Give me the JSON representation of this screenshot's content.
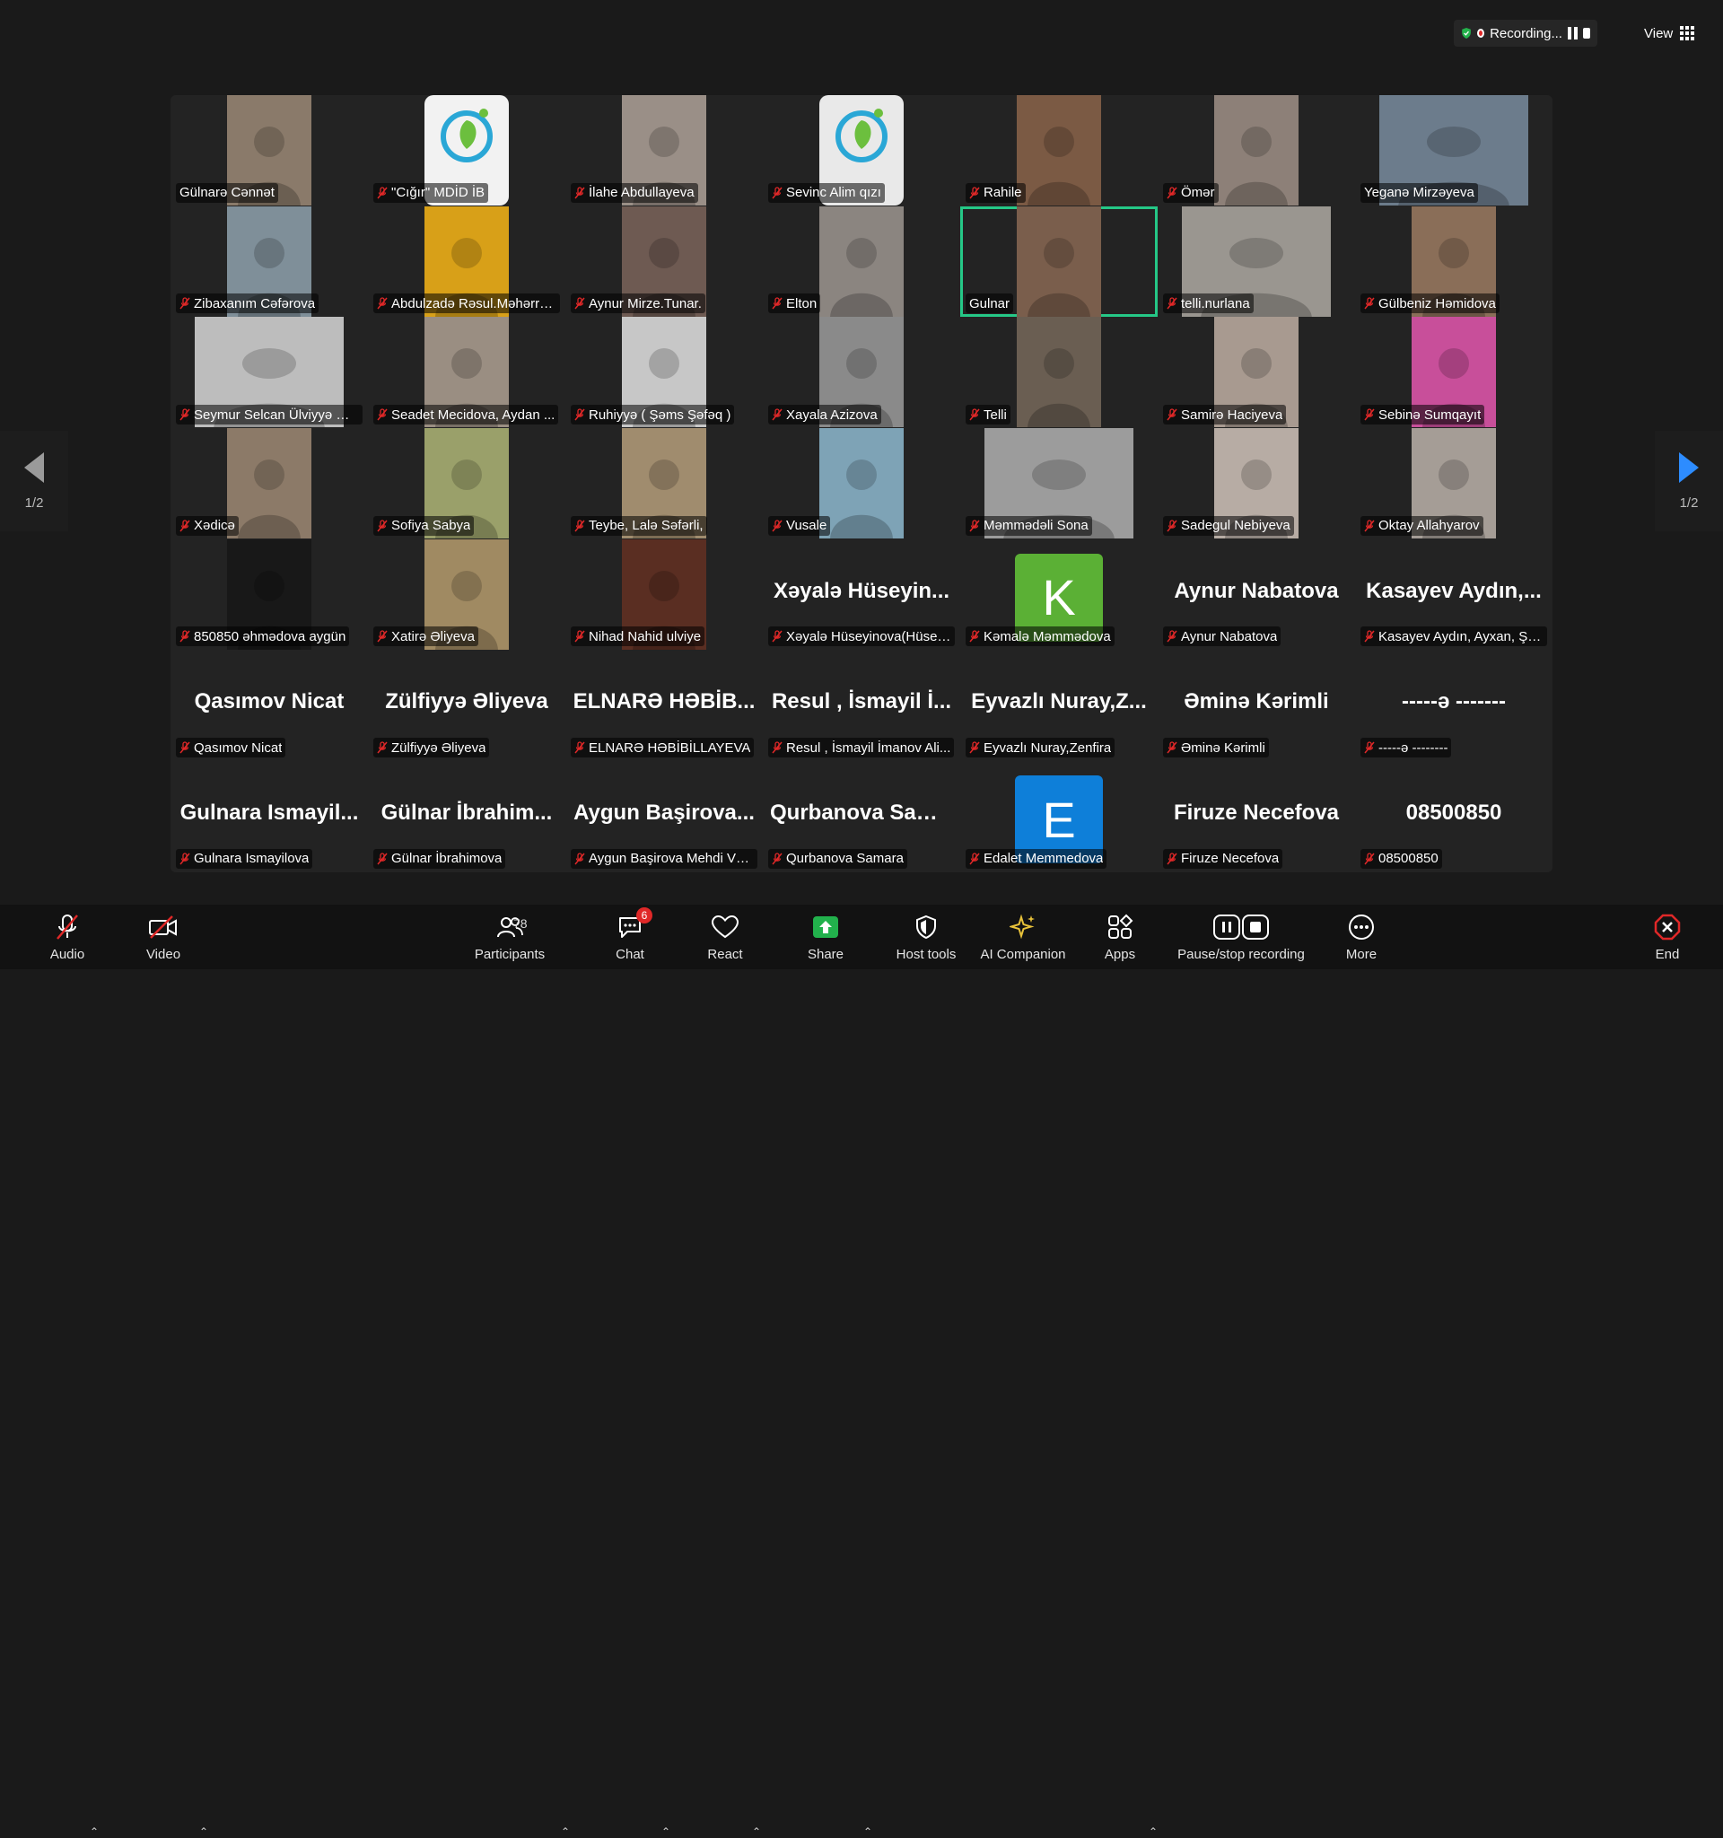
{
  "top": {
    "recording_label": "Recording...",
    "view_label": "View"
  },
  "nav": {
    "page_left": "1/2",
    "page_right": "1/2"
  },
  "colors": {
    "accent_green": "#25c887",
    "blue": "#2d8cff",
    "danger": "#e02828"
  },
  "tiles": [
    {
      "label": "Gülnarə Cənnət",
      "mode": "video",
      "muted": false,
      "bg": "#8a7a6a"
    },
    {
      "label": "\"Cığır\" MDİD İB",
      "mode": "logo",
      "muted": true,
      "bg": "#f2f2f2"
    },
    {
      "label": "İlahe Abdullayeva",
      "mode": "video",
      "muted": true,
      "bg": "#9a8f87"
    },
    {
      "label": "Sevinc Alim qızı",
      "mode": "logo",
      "muted": true,
      "bg": "#e9e9e9"
    },
    {
      "label": "Rahile",
      "mode": "video",
      "muted": true,
      "bg": "#7b5a44"
    },
    {
      "label": "Ömər",
      "mode": "video",
      "muted": true,
      "bg": "#8d8078"
    },
    {
      "label": "Yeganə Mirzəyeva",
      "mode": "video-wide",
      "muted": false,
      "bg": "#6c7c8c"
    },
    {
      "label": "Zibaxanım Cəfərova",
      "mode": "video",
      "muted": true,
      "bg": "#7f8f99"
    },
    {
      "label": "Abdulzadə Rəsul.Məhərrə...",
      "mode": "video",
      "muted": true,
      "bg": "#d8a018"
    },
    {
      "label": "Aynur Mirze.Tunar.",
      "mode": "video",
      "muted": true,
      "bg": "#6e5a52"
    },
    {
      "label": "Elton",
      "mode": "video",
      "muted": true,
      "bg": "#8b8580"
    },
    {
      "label": "Gulnar",
      "mode": "video",
      "muted": false,
      "bg": "#7a5e4c",
      "active": true
    },
    {
      "label": "telli.nurlana",
      "mode": "video-wide",
      "muted": true,
      "bg": "#9a9690"
    },
    {
      "label": "Gülbeniz Həmidova",
      "mode": "video",
      "muted": true,
      "bg": "#8a6e58"
    },
    {
      "label": "Seymur Selcan Ülviyyə Əl...",
      "mode": "video-wide",
      "muted": true,
      "bg": "#bdbdbd"
    },
    {
      "label": "Seadet Mecidova, Aydan ...",
      "mode": "video",
      "muted": true,
      "bg": "#9a8e82"
    },
    {
      "label": "Ruhiyyə ( Şəms Şəfəq )",
      "mode": "video",
      "muted": true,
      "bg": "#c7c7c7"
    },
    {
      "label": "Xayala Azizova",
      "mode": "video",
      "muted": true,
      "bg": "#8a8a8a"
    },
    {
      "label": "Telli",
      "mode": "video",
      "muted": true,
      "bg": "#6a5e52"
    },
    {
      "label": "Samirə Haciyeva",
      "mode": "video",
      "muted": true,
      "bg": "#a89a90"
    },
    {
      "label": "Sebinə Sumqayıt",
      "mode": "video",
      "muted": true,
      "bg": "#c84f9a"
    },
    {
      "label": "Xədicə",
      "mode": "video",
      "muted": true,
      "bg": "#8c7a68"
    },
    {
      "label": "Sofiya Sabya",
      "mode": "video",
      "muted": true,
      "bg": "#9aa06a"
    },
    {
      "label": "Teybe, Lalə Səfərli,",
      "mode": "video",
      "muted": true,
      "bg": "#a08c6e"
    },
    {
      "label": "Vusale",
      "mode": "video",
      "muted": true,
      "bg": "#7ea3b6"
    },
    {
      "label": "Məmmədəli Sona",
      "mode": "video-wide",
      "muted": true,
      "bg": "#9c9c9c"
    },
    {
      "label": "Sadegul Nebiyeva",
      "mode": "video",
      "muted": true,
      "bg": "#b7aca4"
    },
    {
      "label": "Oktay Allahyarov",
      "mode": "video",
      "muted": true,
      "bg": "#a59d96"
    },
    {
      "label": "850850 əhmədova aygün",
      "mode": "video",
      "muted": true,
      "bg": "#181818"
    },
    {
      "label": "Xatirə Əliyeva",
      "mode": "video",
      "muted": true,
      "bg": "#a08a62"
    },
    {
      "label": "Nihad Nahid ulviye",
      "mode": "video",
      "muted": true,
      "bg": "#5a2e22"
    },
    {
      "label": "Xəyalə Hüseyinova(Hüsey...",
      "mode": "name",
      "big": "Xəyalə Hüseyin...",
      "muted": true
    },
    {
      "label": "Kəmalə Məmmədova",
      "mode": "avatar",
      "letter": "K",
      "avatar_color": "#5bb035",
      "muted": true
    },
    {
      "label": "Aynur Nabatova",
      "mode": "name",
      "big": "Aynur Nabatova",
      "muted": true
    },
    {
      "label": "Kasayev Aydın, Ayxan, Şa...",
      "mode": "name",
      "big": "Kasayev Aydın,...",
      "muted": true
    },
    {
      "label": "Qasımov Nicat",
      "mode": "name",
      "big": "Qasımov Nicat",
      "muted": true
    },
    {
      "label": "Zülfiyyə Əliyeva",
      "mode": "name",
      "big": "Zülfiyyə Əliyeva",
      "muted": true
    },
    {
      "label": "ELNARƏ HƏBİBİLLAYEVA",
      "mode": "name",
      "big": "ELNARƏ HƏBİB...",
      "muted": true
    },
    {
      "label": "Resul , İsmayil İmanov Ali...",
      "mode": "name",
      "big": "Resul , İsmayil İ...",
      "muted": true
    },
    {
      "label": "Eyvazlı Nuray,Zenfira",
      "mode": "name",
      "big": "Eyvazlı Nuray,Z...",
      "muted": true
    },
    {
      "label": "Əminə Kərimli",
      "mode": "name",
      "big": "Əminə Kərimli",
      "muted": true
    },
    {
      "label": "-----ə --------",
      "mode": "name",
      "big": "-----ə -------",
      "muted": true
    },
    {
      "label": "Gulnara Ismayilova",
      "mode": "name",
      "big": "Gulnara Ismayil...",
      "muted": true
    },
    {
      "label": "Gülnar İbrahimova",
      "mode": "name",
      "big": "Gülnar İbrahim...",
      "muted": true
    },
    {
      "label": "Aygun Başirova Mehdi Və...",
      "mode": "name",
      "big": "Aygun Başirova...",
      "muted": true
    },
    {
      "label": "Qurbanova Samara",
      "mode": "name",
      "big": "Qurbanova Sam...",
      "muted": true
    },
    {
      "label": "Edalet Memmedova",
      "mode": "avatar",
      "letter": "E",
      "avatar_color": "#0e7fd9",
      "muted": true
    },
    {
      "label": "Firuze Necefova",
      "mode": "name",
      "big": "Firuze Necefova",
      "muted": true
    },
    {
      "label": "08500850",
      "mode": "name",
      "big": "08500850",
      "muted": true
    }
  ],
  "toolbar": {
    "audio": "Audio",
    "video": "Video",
    "participants": "Participants",
    "participants_count": "78",
    "chat": "Chat",
    "chat_badge": "6",
    "react": "React",
    "share": "Share",
    "host_tools": "Host tools",
    "ai_companion": "AI Companion",
    "apps": "Apps",
    "pause_stop": "Pause/stop recording",
    "more": "More",
    "end": "End"
  }
}
